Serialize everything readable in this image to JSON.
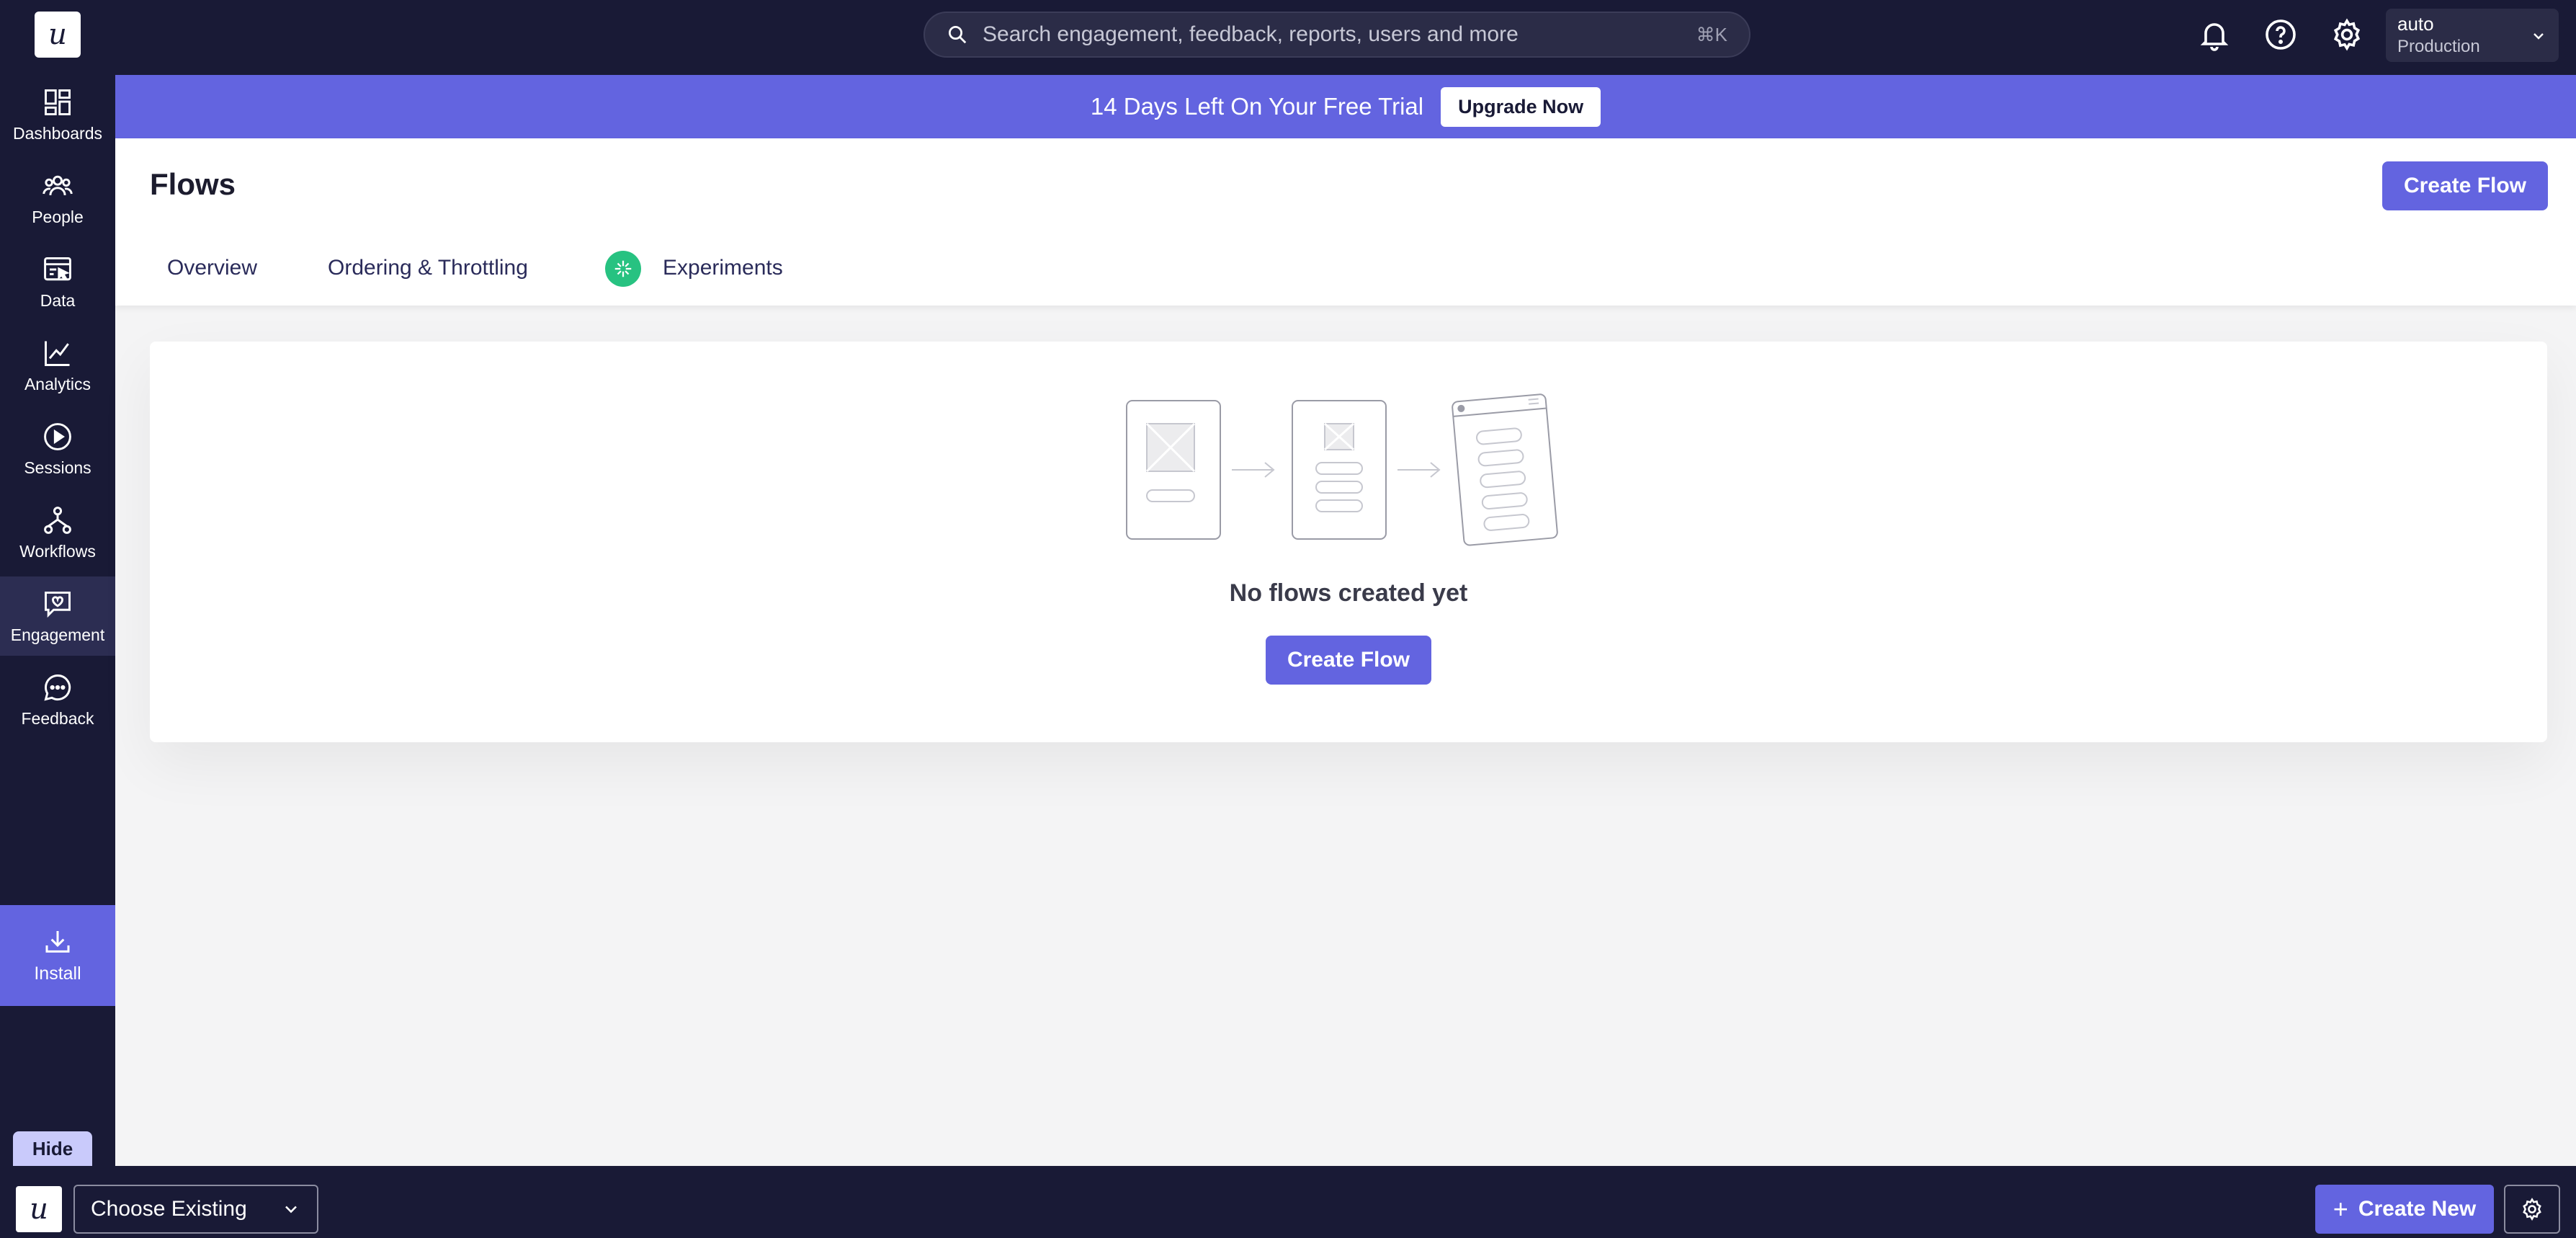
{
  "app": {
    "logo_letter": "u"
  },
  "search": {
    "placeholder": "Search engagement, feedback, reports, users and more",
    "shortcut": "⌘K"
  },
  "environment": {
    "name": "auto",
    "stage": "Production"
  },
  "sidebar": {
    "items": [
      {
        "label": "Dashboards",
        "icon": "dashboard-icon"
      },
      {
        "label": "People",
        "icon": "people-icon"
      },
      {
        "label": "Data",
        "icon": "data-icon"
      },
      {
        "label": "Analytics",
        "icon": "analytics-icon"
      },
      {
        "label": "Sessions",
        "icon": "play-icon"
      },
      {
        "label": "Workflows",
        "icon": "workflow-icon"
      },
      {
        "label": "Engagement",
        "icon": "engagement-icon",
        "active": true
      },
      {
        "label": "Feedback",
        "icon": "chat-icon"
      }
    ],
    "install_label": "Install",
    "hide_label": "Hide"
  },
  "banner": {
    "text": "14 Days Left On Your Free Trial",
    "button": "Upgrade Now"
  },
  "page": {
    "title": "Flows",
    "create_button": "Create Flow",
    "tabs": [
      "Overview",
      "Ordering & Throttling",
      "Experiments"
    ]
  },
  "empty_state": {
    "message": "No flows created yet",
    "button": "Create Flow"
  },
  "bottom_bar": {
    "logo_letter": "u",
    "choose_label": "Choose Existing",
    "create_new_label": "Create New"
  },
  "colors": {
    "nav_bg": "#191a36",
    "accent": "#6364e0",
    "experiment_badge": "#27c281"
  }
}
